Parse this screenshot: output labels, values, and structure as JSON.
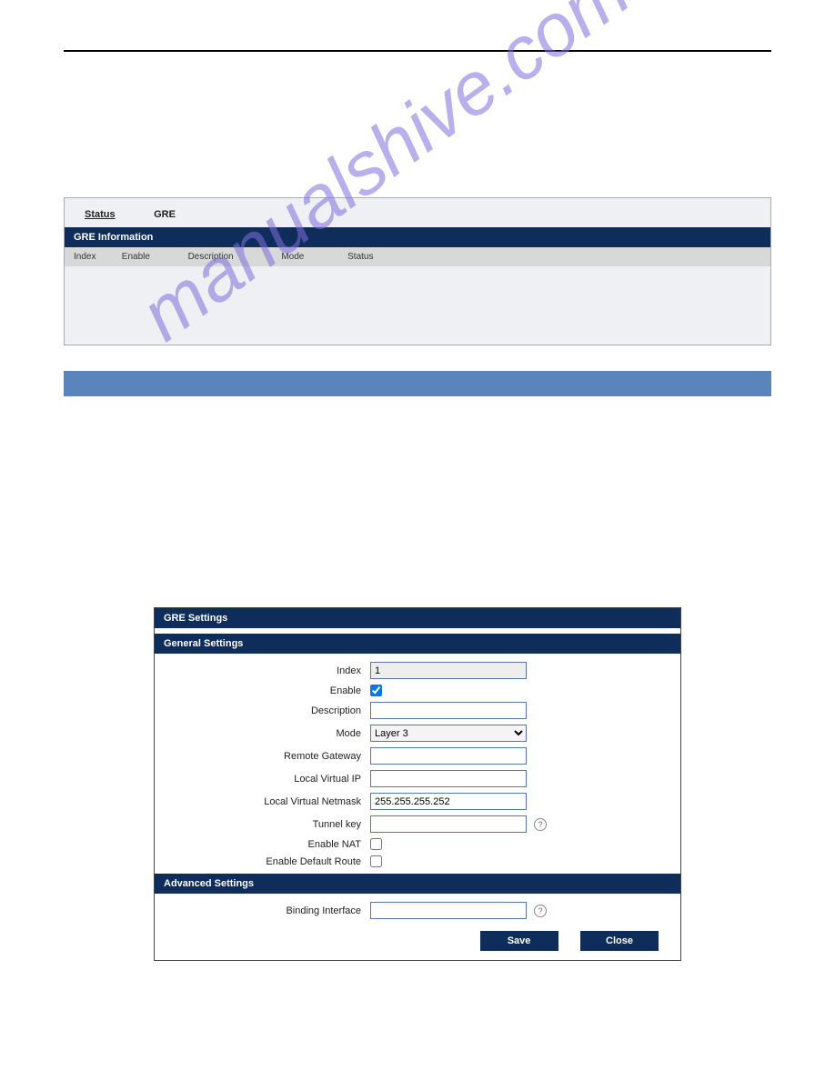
{
  "tabs": {
    "status": "Status",
    "gre": "GRE"
  },
  "panel1": {
    "title": "GRE Information",
    "cols": {
      "c1": "Index",
      "c2": "Enable",
      "c3": "Description",
      "c4": "Mode",
      "c5": "Status"
    }
  },
  "panel2": {
    "title": "GRE Settings",
    "sec1": "General Settings",
    "sec2": "Advanced Settings",
    "labels": {
      "index": "Index",
      "enable": "Enable",
      "description": "Description",
      "mode": "Mode",
      "remote_gateway": "Remote Gateway",
      "local_virtual_ip": "Local Virtual IP",
      "local_virtual_netmask": "Local Virtual Netmask",
      "tunnel_key": "Tunnel key",
      "enable_nat": "Enable NAT",
      "enable_default_route": "Enable Default Route",
      "binding_interface": "Binding Interface"
    },
    "values": {
      "index": "1",
      "description": "",
      "mode": "Layer 3",
      "remote_gateway": "",
      "local_virtual_ip": "",
      "local_virtual_netmask": "255.255.255.252",
      "tunnel_key": "",
      "binding_interface": ""
    },
    "buttons": {
      "save": "Save",
      "close": "Close"
    },
    "help": "?"
  },
  "watermark": "manualshive.com"
}
